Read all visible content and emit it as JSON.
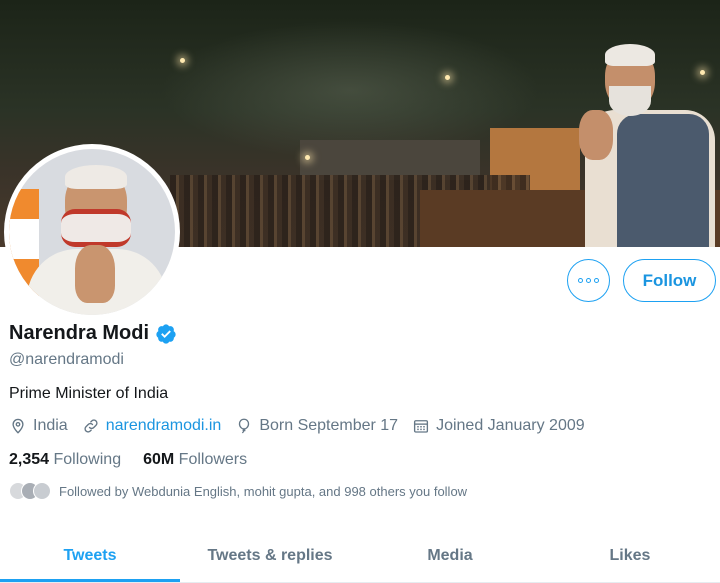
{
  "profile": {
    "name": "Narendra Modi",
    "handle": "@narendramodi",
    "bio": "Prime Minister of India",
    "verified": true
  },
  "meta": {
    "location": "India",
    "website": "narendramodi.in",
    "born": "Born September 17",
    "joined": "Joined January 2009"
  },
  "stats": {
    "following_count": "2,354",
    "following_label": "Following",
    "followers_count": "60M",
    "followers_label": "Followers"
  },
  "followed_by": "Followed by Webdunia English, mohit gupta, and 998 others you follow",
  "buttons": {
    "follow": "Follow",
    "more_icon": "more-icon"
  },
  "tabs": [
    {
      "label": "Tweets",
      "active": true
    },
    {
      "label": "Tweets & replies",
      "active": false
    },
    {
      "label": "Media",
      "active": false
    },
    {
      "label": "Likes",
      "active": false
    }
  ],
  "icons": {
    "location": "location-pin-icon",
    "website": "link-icon",
    "born": "balloon-icon",
    "joined": "calendar-icon",
    "verified": "verified-badge-icon"
  },
  "colors": {
    "accent": "#1da1f2",
    "link": "#1b95e0",
    "secondary_text": "#657786",
    "primary_text": "#14171a"
  }
}
